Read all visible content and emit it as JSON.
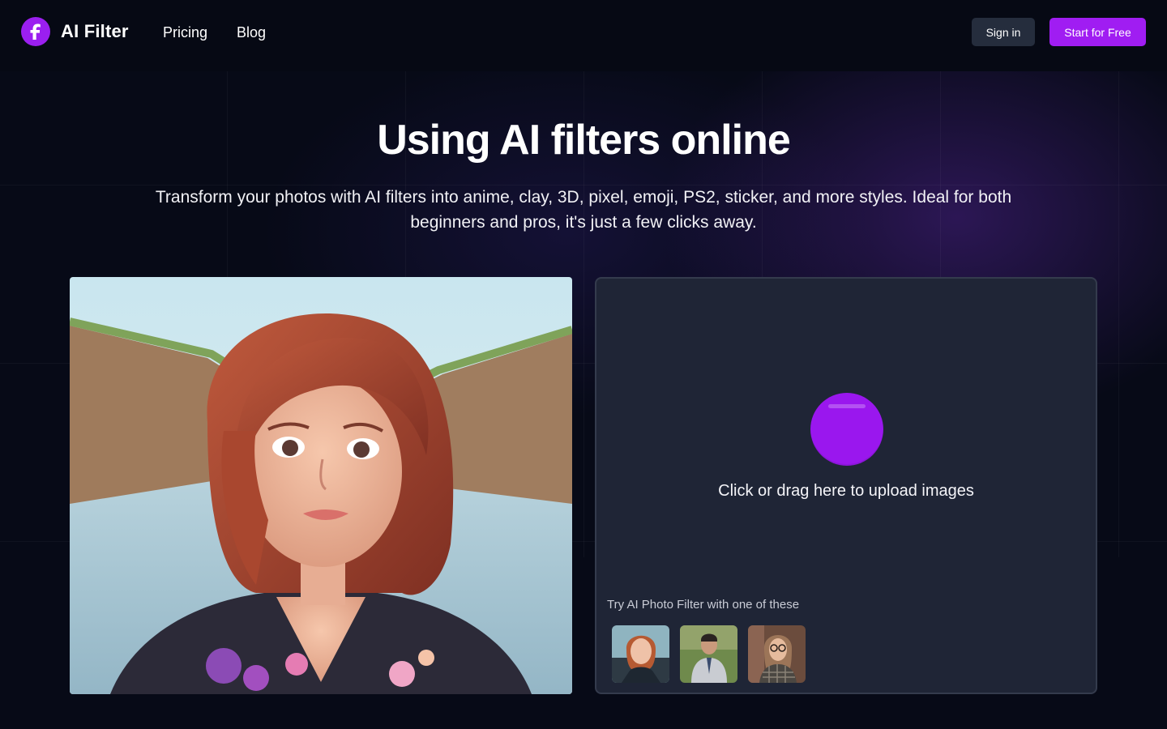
{
  "header": {
    "logo_letter": "f",
    "logo_text": "AI Filter",
    "nav": [
      {
        "label": "Pricing"
      },
      {
        "label": "Blog"
      }
    ],
    "signin_label": "Sign in",
    "start_label": "Start for Free"
  },
  "hero": {
    "title": "Using AI filters online",
    "subtitle": "Transform your photos with AI filters into anime, clay, 3D, pixel, emoji, PS2, sticker, and more styles. Ideal for both beginners and pros, it's just a few clicks away."
  },
  "upload": {
    "prompt": "Click or drag here to upload images",
    "try_label": "Try AI Photo Filter with one of these",
    "accent_color": "#9a17ee"
  },
  "colors": {
    "brand": "#a01df2",
    "background": "#070a17",
    "panel": "#1f2536"
  }
}
